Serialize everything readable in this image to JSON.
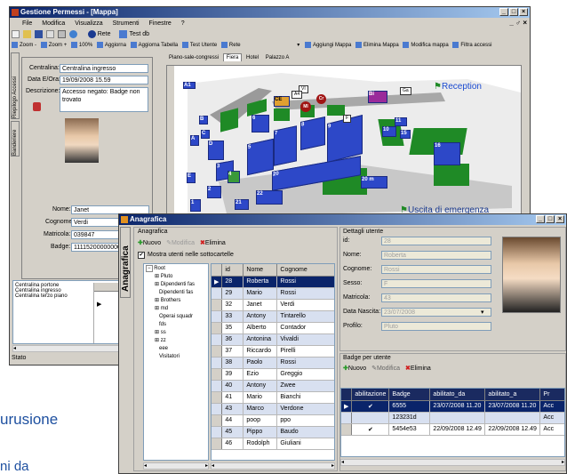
{
  "main_window": {
    "title": "Gestione Permessi - [Mappa]",
    "menu": [
      "File",
      "Modifica",
      "Visualizza",
      "Strumenti",
      "Finestre",
      "?"
    ],
    "toolbar1": {
      "rete": "Rete",
      "test_db": "Test db"
    },
    "toolbar2": [
      "Zoom -",
      "Zoom +",
      "100%",
      "Aggiorna",
      "Aggiorna Tabella",
      "Test Utente",
      "Rete"
    ],
    "toolbar2_right": [
      "Aggiungi Mappa",
      "Elimina Mappa",
      "Modifica mappa",
      "Filtra accessi"
    ],
    "side_tabs": [
      "Riepilogo Accessi",
      "Banderiere"
    ],
    "access": {
      "centralina_label": "Centralina:",
      "centralina": "Centralina ingresso",
      "data_label": "Data E/Ora:",
      "data": "19/09/2008 15.59",
      "desc_label": "Descrizione:",
      "desc": "Accesso negato: Badge non trovato"
    },
    "user": {
      "nome_label": "Nome:",
      "nome": "Janet",
      "cognome_label": "Cognome:",
      "cognome": "Verdi",
      "matricola_label": "Matricola:",
      "matricola": "039847",
      "badge_label": "Badge:",
      "badge": "1111520000000003300"
    },
    "centraline": [
      "Centralina portone",
      "Centralina ingresso",
      "Centralina terzo piano"
    ],
    "status": "Stato",
    "map_tabs": [
      "Piano-sale-congressi",
      "Fiera",
      "Hotel",
      "Palazzo A"
    ],
    "map_active_tab": "Fiera",
    "reception": "Reception",
    "uscita": "Uscita di emergenza",
    "buildings": [
      "A1",
      "A",
      "B",
      "C",
      "D",
      "E",
      "F",
      "1",
      "2",
      "3",
      "4",
      "5",
      "6",
      "7",
      "8",
      "9",
      "10",
      "11",
      "15",
      "16",
      "20",
      "20 m",
      "21",
      "22",
      "CE",
      "VI",
      "MI",
      "Cr",
      "Bi",
      "Ga",
      "A4"
    ]
  },
  "ana": {
    "title": "Anagrafica",
    "vertical": "Anagrafica",
    "group": "Anagrafica",
    "nuovo": "Nuovo",
    "modifica": "Modifica",
    "elimina": "Elimina",
    "check_label": "Mostra utenti nelle sottocartelle",
    "tree": [
      "Root",
      "Pluto",
      "Dipendenti fas",
      "Dipendenti fas",
      "Brothers",
      "md",
      "Operai squadr",
      "fds",
      "ss",
      "zz",
      "eee",
      "Visitatori"
    ],
    "grid_headers": [
      "id",
      "Nome",
      "Cognome"
    ],
    "grid_rows": [
      [
        "28",
        "Roberta",
        "Rossi"
      ],
      [
        "29",
        "Mario",
        "Rossi"
      ],
      [
        "32",
        "Janet",
        "Verdi"
      ],
      [
        "33",
        "Antony",
        "Tintarello"
      ],
      [
        "35",
        "Alberto",
        "Contador"
      ],
      [
        "36",
        "Antonina",
        "Vivaldi"
      ],
      [
        "37",
        "Riccardo",
        "Pirelli"
      ],
      [
        "38",
        "Paolo",
        "Rossi"
      ],
      [
        "39",
        "Ezio",
        "Greggio"
      ],
      [
        "40",
        "Antony",
        "Zwee"
      ],
      [
        "41",
        "Mario",
        "Bianchi"
      ],
      [
        "43",
        "Marco",
        "Verdone"
      ],
      [
        "44",
        "poop",
        "ppo"
      ],
      [
        "45",
        "Pippo",
        "Baudo"
      ],
      [
        "46",
        "Rodolph",
        "Giuliani"
      ]
    ],
    "details_title": "Dettagli utente",
    "details": [
      {
        "label": "id:",
        "value": "28"
      },
      {
        "label": "Nome:",
        "value": "Roberta"
      },
      {
        "label": "Cognome:",
        "value": "Rossi"
      },
      {
        "label": "Sesso:",
        "value": "F"
      },
      {
        "label": "Matricola:",
        "value": "43"
      },
      {
        "label": "Data Nascita:",
        "value": "23/07/2008"
      },
      {
        "label": "Profilo:",
        "value": "Pluto"
      }
    ],
    "badge_title": "Badge per utente",
    "badge_headers": [
      "abilitazione",
      "Badge",
      "abilitato_da",
      "abilitato_a",
      "Pr"
    ],
    "badge_rows": [
      [
        "✔",
        "6555",
        "23/07/2008 11.20",
        "23/07/2008 11.20",
        "Acc"
      ],
      [
        "",
        "123231d",
        "",
        "",
        "Acc"
      ],
      [
        "✔",
        "5454e53",
        "22/09/2008 12.49",
        "22/09/2008 12.49",
        "Acc"
      ]
    ]
  },
  "bg_text": [
    "urusione",
    "ni da"
  ]
}
